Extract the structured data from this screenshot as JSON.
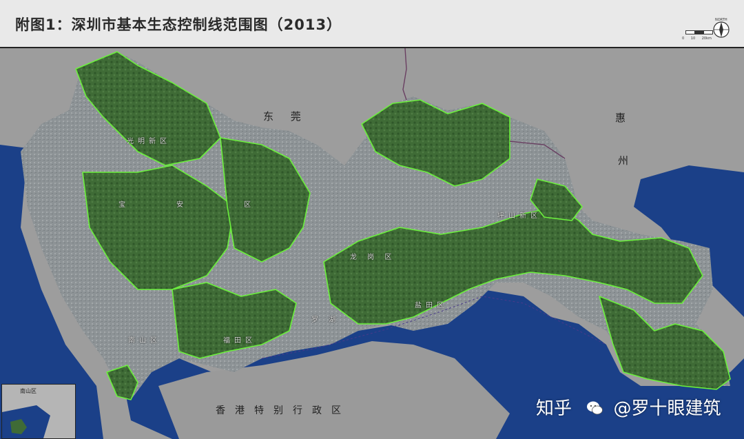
{
  "title": "附图1：深圳市基本生态控制线范围图（2013）",
  "legend": {
    "compass_label": "NORTH",
    "scale_labels": [
      "0",
      "10",
      "20km"
    ]
  },
  "places": {
    "dongguan": "东 莞",
    "huizhou_1": "惠",
    "huizhou_2": "州",
    "hongkong": "香港特别行政区"
  },
  "districts": {
    "guangming": "光明新区",
    "baoan_1": "宝",
    "baoan_2": "安",
    "baoan_3": "区",
    "longgang": "龙 岗 区",
    "pingshan": "坪山新区",
    "nanshan": "南山区",
    "futian": "福田区",
    "luohu": "罗 湖",
    "yantian": "盐田区"
  },
  "inset": {
    "label": "南山区"
  },
  "watermark": {
    "site": "知乎",
    "author": "@罗十眼建筑"
  },
  "colors": {
    "sea": "#1a3f86",
    "land_outside": "#9b9b9b",
    "urban": "#8c9295",
    "ecological_zone": "#3d6a35",
    "eco_outline": "#6bf03c",
    "boundary": "#6a3f62"
  }
}
